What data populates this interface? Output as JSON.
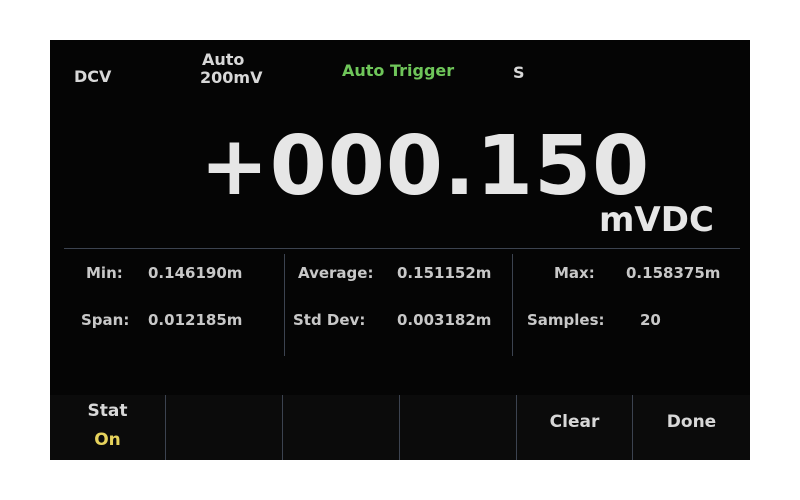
{
  "status_bar": {
    "function": "DCV",
    "range_mode": "Auto",
    "range_value": "200mV",
    "trigger": "Auto Trigger",
    "rate": "S"
  },
  "main_reading": {
    "value": "+000.150",
    "unit": "mVDC"
  },
  "statistics": {
    "min_label": "Min:",
    "min_value": "0.146190m",
    "average_label": "Average:",
    "average_value": "0.151152m",
    "max_label": "Max:",
    "max_value": "0.158375m",
    "span_label": "Span:",
    "span_value": "0.012185m",
    "stddev_label": "Std Dev:",
    "stddev_value": "0.003182m",
    "samples_label": "Samples:",
    "samples_value": "20"
  },
  "softkeys": {
    "stat_label": "Stat",
    "stat_state": "On",
    "clear_label": "Clear",
    "done_label": "Done"
  },
  "colors": {
    "trigger_green": "#6fc65a",
    "state_yellow": "#e6d25c",
    "background": "#050505",
    "divider": "#3c4350"
  }
}
